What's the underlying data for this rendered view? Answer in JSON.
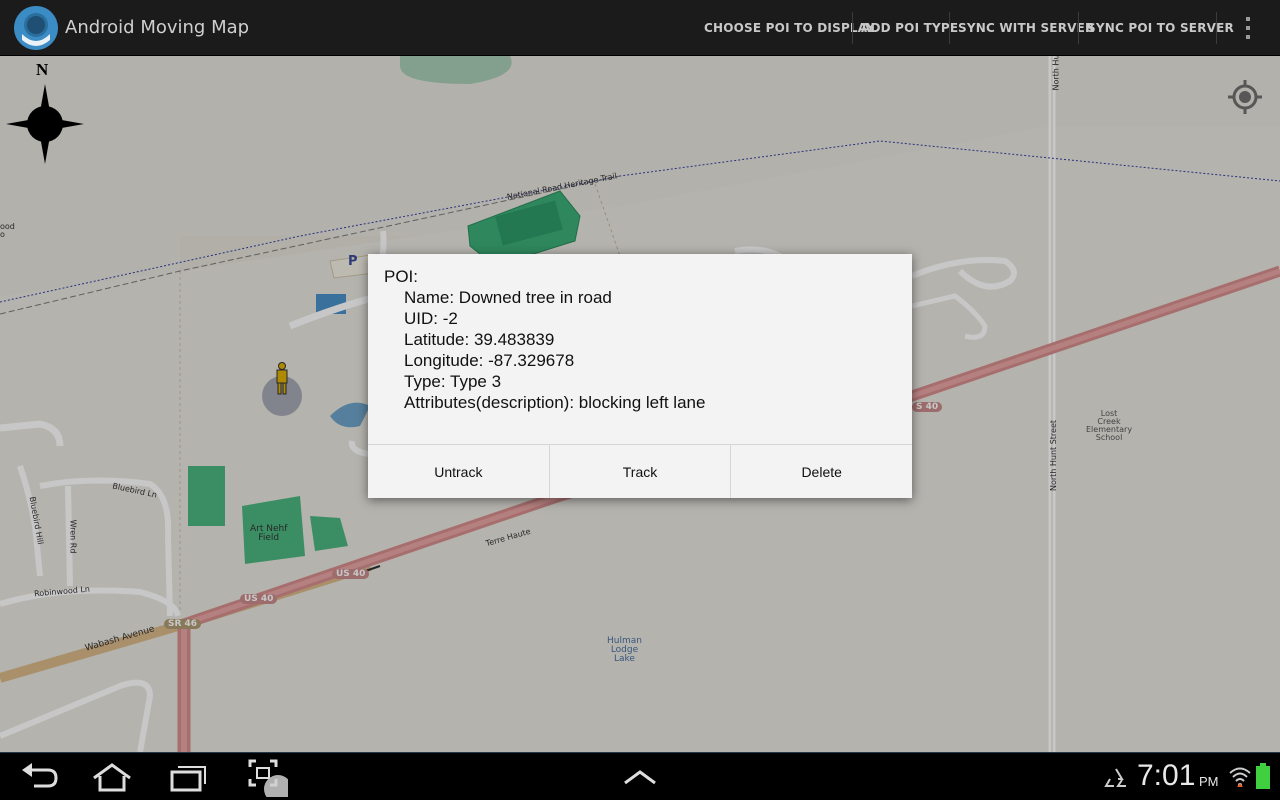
{
  "app": {
    "title": "Android Moving Map",
    "actions": [
      {
        "label": "CHOOSE POI TO DISPLAY"
      },
      {
        "label": "ADD POI TYPE"
      },
      {
        "label": "SYNC WITH SERVER"
      },
      {
        "label": "SYNC POI TO SERVER"
      }
    ]
  },
  "map": {
    "compass_label": "N",
    "labels": {
      "trail": "National Road Heritage Trail",
      "parking": "P",
      "art_nehf": "Art Nehf\nField",
      "us40_a": "US 40",
      "us40_b": "US 40",
      "us40_c": "S 40",
      "sr46": "SR 46",
      "terre_haute": "Terre Haute",
      "wabash": "Wabash Avenue",
      "robinwood": "Robinwood Ln",
      "bluebird_ln": "Bluebird Ln",
      "bluebird_hill": "Bluebird Hill",
      "wren_rd": "Wren Rd",
      "north_hunt_1": "North Hunt Street",
      "north_hunt_2": "North Hu",
      "lost_creek": "Lost\nCreek\nElementary\nSchool",
      "hulman": "Hulman\nLodge\nLake",
      "edge_left": "ood\no"
    }
  },
  "dialog": {
    "heading": "POI:",
    "name": "Name: Downed tree in road",
    "uid": "UID: -2",
    "latitude": "Latitude: 39.483839",
    "longitude": "Longitude: -87.329678",
    "type": "Type: Type 3",
    "attributes": "Attributes(description): blocking left lane",
    "buttons": {
      "untrack": "Untrack",
      "track": "Track",
      "delete": "Delete"
    }
  },
  "status": {
    "time": "7:01",
    "ampm": "PM"
  },
  "colors": {
    "actionbar": "#1b1b1b",
    "map_background": "#e6e3dc",
    "road_major": "#e48f90",
    "green_area": "#3cae78",
    "dialog_bg": "#f3f3f3",
    "battery": "#3fcf3f"
  }
}
